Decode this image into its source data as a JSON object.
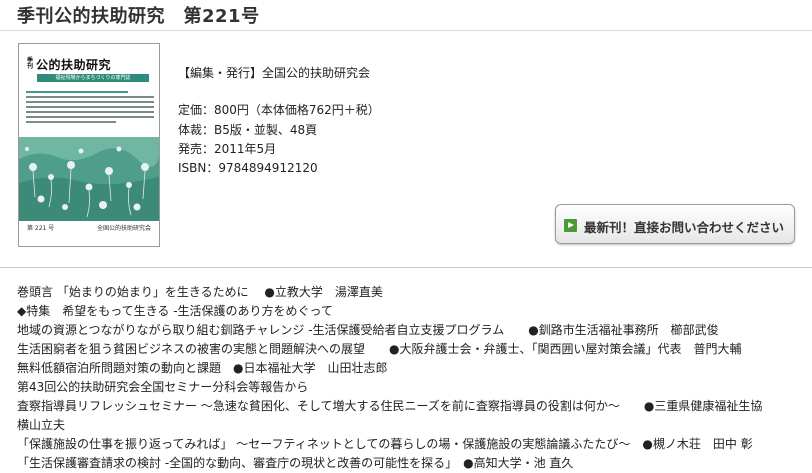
{
  "page_title": "季刊公的扶助研究　第221号",
  "cover": {
    "magazine_label": "季刊",
    "title": "公的扶助研究",
    "subtitle": "福祉現場からまちづくりの専門誌",
    "issue": "第 221 号",
    "publisher": "全国公的扶助研究会"
  },
  "info": {
    "publisher": "【編集・発行】全国公的扶助研究会",
    "price": "定価：800円（本体価格762円＋税）",
    "format": "体裁：B5版・並製、48頁",
    "release": "発売：2011年5月",
    "isbn": "ISBN：9784894912120"
  },
  "contact_button": {
    "label": "最新刊！直接お問い合わせください",
    "icon": "play-arrow-icon",
    "accent_color": "#4a9a36"
  },
  "contents": [
    "巻頭言 「始まりの始まり」を生きるために 　●立教大学　湯澤直美",
    "◆特集　希望をもって生きる ‐生活保護のあり方をめぐって",
    "地域の資源とつながりながら取り組む釧路チャレンジ ‐生活保護受給者自立支援プログラム　　●釧路市生活福祉事務所　櫛部武俊",
    "生活困窮者を狙う貧困ビジネスの被害の実態と問題解決への展望　　●大阪弁護士会・弁護士、「関西囲い屋対策会議」代表　普門大輔",
    "無料低額宿泊所問題対策の動向と課題　●日本福祉大学　山田壮志郎",
    "第43回公的扶助研究会全国セミナー分科会等報告から",
    "査察指導員リフレッシュセミナー ～急速な貧困化、そして増大する住民ニーズを前に査察指導員の役割は何か～　　●三重県健康福祉生協",
    "横山立夫",
    "「保護施設の仕事を振り返ってみれば」 ～セーフティネットとしての暮らしの場・保護施設の実態論議ふたたび～　●槻ノ木荘　田中 彰",
    "「生活保護審査請求の検討 ‐全国的な動向、審査庁の現状と改善の可能性を探る」　●高知大学・池 直久"
  ]
}
